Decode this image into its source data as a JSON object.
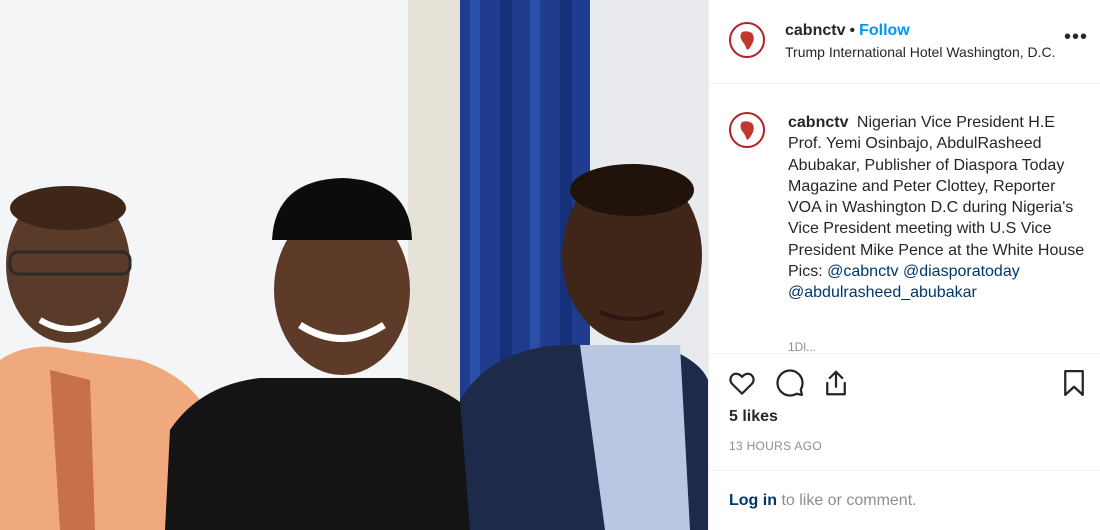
{
  "post": {
    "username": "cabnctv",
    "separator": "•",
    "follow_label": "Follow",
    "location": "Trump International Hotel Washington, D.C.",
    "more_label": "•••"
  },
  "caption": {
    "username": "cabnctv",
    "text": "Nigerian Vice President H.E Prof. Yemi Osinbajo, AbdulRasheed Abubakar, Publisher of Diaspora Today Magazine and Peter Clottey, Reporter VOA in Washington D.C during Nigeria's Vice President meeting with U.S Vice President Mike Pence at the White House",
    "pics_label": "Pics:",
    "tags": [
      "@cabnctv",
      "@diasporatoday",
      "@abdulrasheed_abubakar"
    ],
    "partial_text": "1Dl..."
  },
  "actions": {
    "icons": [
      "heart-icon",
      "comment-icon",
      "share-icon",
      "bookmark-icon"
    ]
  },
  "likes": "5 likes",
  "time": "13 HOURS AGO",
  "footer": {
    "login_label": "Log in",
    "rest_text": "to like or comment."
  },
  "colors": {
    "link_blue": "#0095f6",
    "tag_blue": "#00376b",
    "muted": "#8e8e8e",
    "avatar_ring": "#b21f24"
  }
}
